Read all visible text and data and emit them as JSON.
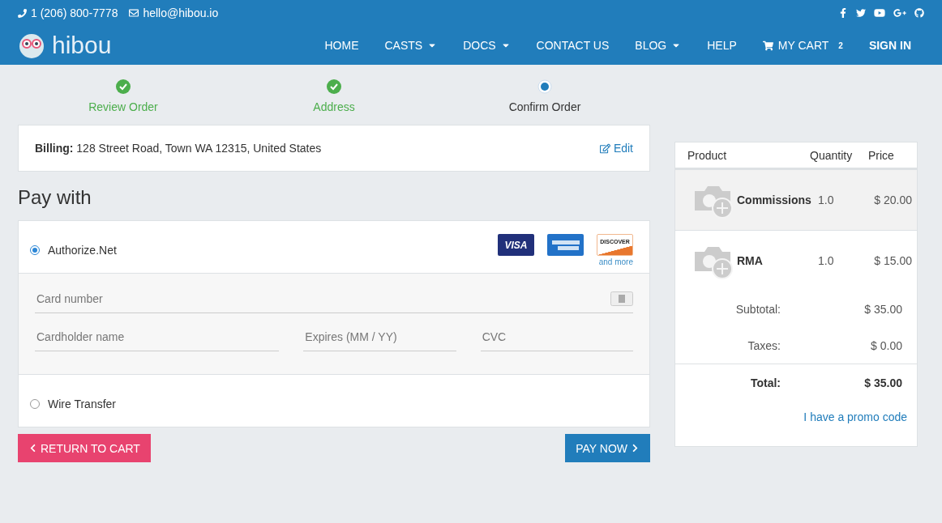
{
  "topbar": {
    "phone": "1 (206) 800-7778",
    "email": "hello@hibou.io"
  },
  "brand": "hibou",
  "nav": [
    {
      "label": "HOME",
      "dropdown": false
    },
    {
      "label": "CASTS",
      "dropdown": true
    },
    {
      "label": "DOCS",
      "dropdown": true
    },
    {
      "label": "CONTACT US",
      "dropdown": false
    },
    {
      "label": "BLOG",
      "dropdown": true
    },
    {
      "label": "HELP",
      "dropdown": false
    }
  ],
  "cart": {
    "label": "MY CART",
    "count": "2"
  },
  "sign_in": "SIGN IN",
  "steps": [
    {
      "label": "Review Order",
      "done": true
    },
    {
      "label": "Address",
      "done": true
    },
    {
      "label": "Confirm Order",
      "done": false
    }
  ],
  "billing": {
    "label": "Billing:",
    "address": "128 Street Road, Town WA 12315, United States",
    "edit": "Edit"
  },
  "pay_title": "Pay with",
  "methods": [
    {
      "label": "Authorize.Net",
      "selected": true,
      "cards": [
        {
          "kind": "visa",
          "text": "VISA"
        },
        {
          "kind": "amex"
        },
        {
          "kind": "discover",
          "text": "DISCOVER"
        }
      ],
      "more": "and more",
      "fields": [
        {
          "placeholder": "Card number"
        },
        {
          "placeholder": "Cardholder name"
        },
        {
          "placeholder": "Expires (MM / YY)"
        },
        {
          "placeholder": "CVC"
        }
      ]
    },
    {
      "label": "Wire Transfer",
      "selected": false
    }
  ],
  "return_button": "RETURN TO CART",
  "pay_button": "PAY NOW",
  "summary": {
    "columns": [
      "Product",
      "Quantity",
      "Price"
    ],
    "rows": [
      {
        "name": "Commissions",
        "qty": "1.0",
        "price": "$ 20.00",
        "highlighted": true
      },
      {
        "name": "RMA",
        "qty": "1.0",
        "price": "$ 15.00",
        "highlighted": false
      }
    ],
    "subtotal": {
      "label": "Subtotal:",
      "value": "$ 35.00"
    },
    "taxes": {
      "label": "Taxes:",
      "value": "$ 0.00"
    },
    "total": {
      "label": "Total:",
      "value": "$ 35.00"
    },
    "promo": "I have a promo code"
  }
}
